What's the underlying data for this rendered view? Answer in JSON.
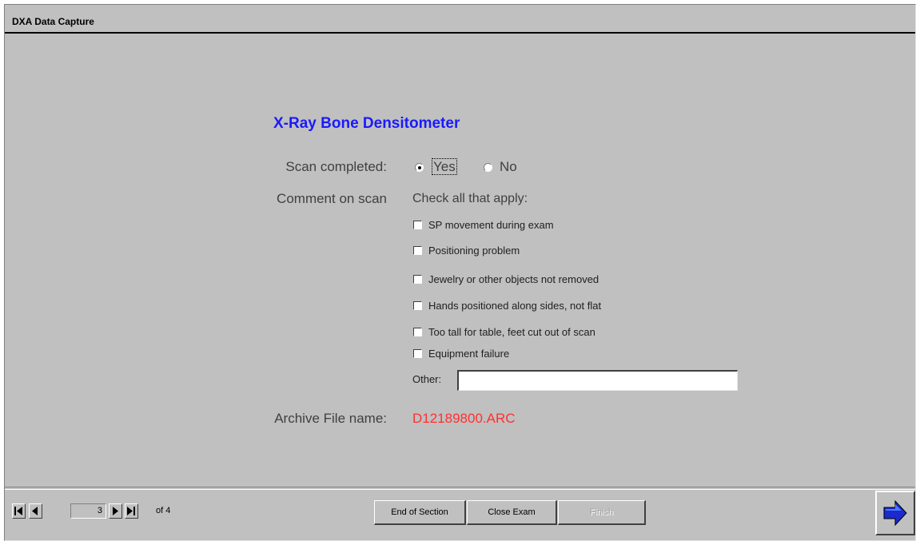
{
  "window": {
    "title": "DXA Data Capture"
  },
  "form": {
    "heading": "X-Ray Bone Densitometer",
    "scan_completed": {
      "label": "Scan completed:",
      "options": [
        "Yes",
        "No"
      ],
      "selected": "Yes"
    },
    "comment": {
      "label": "Comment on scan",
      "help": "Check all that apply:",
      "checkboxes": [
        "SP movement during exam",
        "Positioning problem",
        "Jewelry or other objects not removed",
        "Hands positioned along sides, not flat",
        "Too tall for table, feet cut out of scan",
        "Equipment failure"
      ],
      "other_label": "Other:",
      "other_value": ""
    },
    "archive": {
      "label": "Archive File name:",
      "value": "D12189800.ARC",
      "value_color": "#ff3030"
    }
  },
  "navigation": {
    "current_page": "3",
    "of_label": "of 4"
  },
  "footer": {
    "end_of_section": "End of Section",
    "close_exam": "Close Exam",
    "finish": "Finish"
  },
  "colors": {
    "heading": "#1a1aff",
    "background": "#c0c0c0",
    "next_arrow": "#1a2acc"
  }
}
